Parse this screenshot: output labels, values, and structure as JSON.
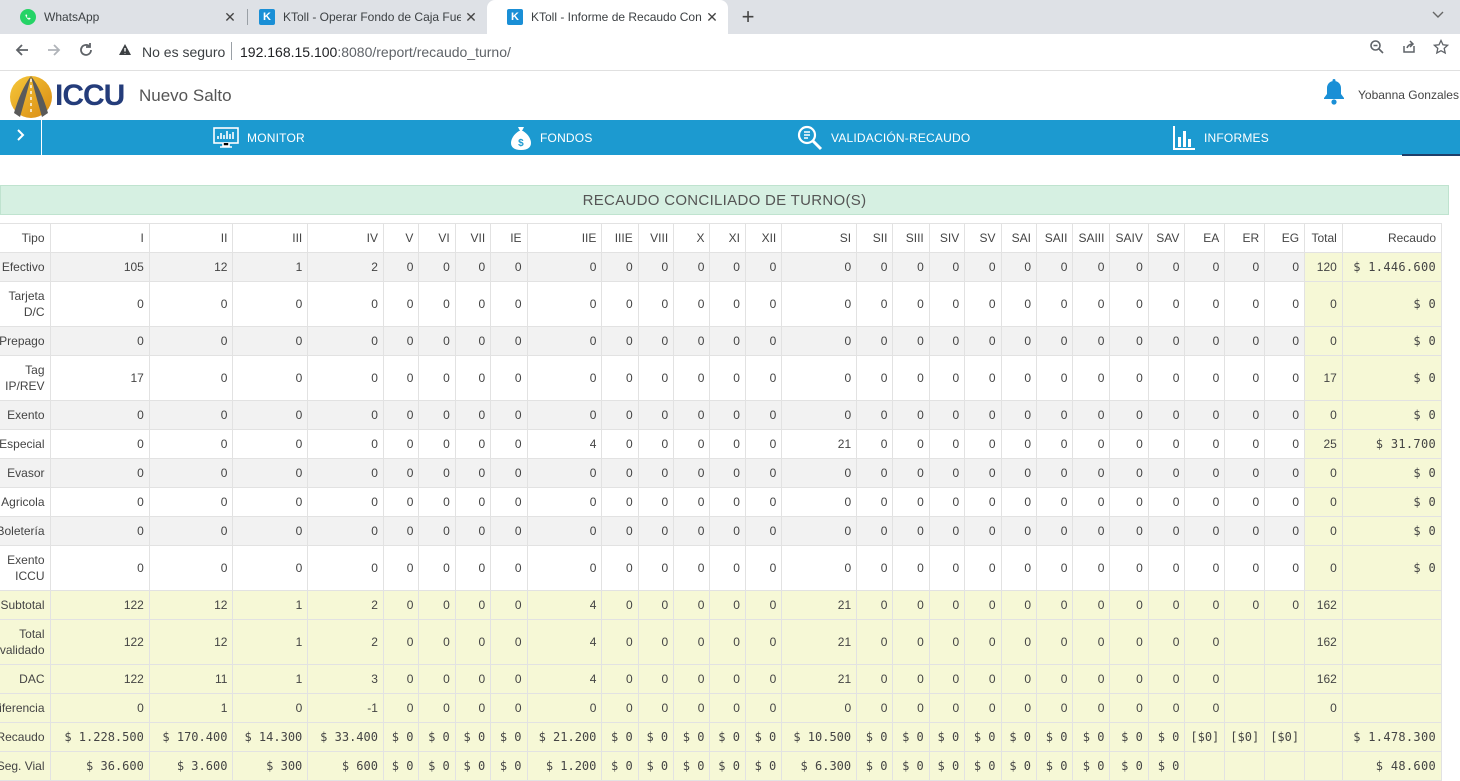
{
  "browser": {
    "tabs": [
      {
        "title": "WhatsApp",
        "icon": "whatsapp-icon",
        "active": false
      },
      {
        "title": "KToll - Operar Fondo de Caja Fuerte",
        "icon": "ktoll-icon",
        "active": false
      },
      {
        "title": "KToll - Informe de Recaudo Conciliado",
        "icon": "ktoll-icon",
        "active": true
      }
    ],
    "security_label": "No es seguro",
    "url_host": "192.168.15.100",
    "url_rest": ":8080/report/recaudo_turno/"
  },
  "header": {
    "logo_text": "ICCU",
    "site_name": "Nuevo Salto",
    "user_name": "Yobanna Gonzales"
  },
  "nav": {
    "items": [
      {
        "label": "MONITOR",
        "icon": "monitor-icon"
      },
      {
        "label": "FONDOS",
        "icon": "money-bag-icon"
      },
      {
        "label": "VALIDACIÓN-RECAUDO",
        "icon": "validation-search-icon"
      },
      {
        "label": "INFORMES",
        "icon": "bar-chart-icon"
      }
    ]
  },
  "report": {
    "title": "RECAUDO CONCILIADO DE TURNO(S)",
    "columns": [
      "Tipo",
      "I",
      "II",
      "III",
      "IV",
      "V",
      "VI",
      "VII",
      "IE",
      "IIE",
      "IIIE",
      "VIII",
      "X",
      "XI",
      "XII",
      "SI",
      "SII",
      "SIII",
      "SIV",
      "SV",
      "SAI",
      "SAII",
      "SAIII",
      "SAIV",
      "SAV",
      "EA",
      "ER",
      "EG",
      "Total",
      "Recaudo"
    ],
    "rows": [
      {
        "label": "Efectivo",
        "cells": [
          "105",
          "12",
          "1",
          "2",
          "0",
          "0",
          "0",
          "0",
          "0",
          "0",
          "0",
          "0",
          "0",
          "0",
          "0",
          "0",
          "0",
          "0",
          "0",
          "0",
          "0",
          "0",
          "0",
          "0",
          "0",
          "0",
          "0",
          "120",
          "$ 1.446.600"
        ]
      },
      {
        "label": "Tarjeta D/C",
        "cells": [
          "0",
          "0",
          "0",
          "0",
          "0",
          "0",
          "0",
          "0",
          "0",
          "0",
          "0",
          "0",
          "0",
          "0",
          "0",
          "0",
          "0",
          "0",
          "0",
          "0",
          "0",
          "0",
          "0",
          "0",
          "0",
          "0",
          "0",
          "0",
          "$ 0"
        ]
      },
      {
        "label": "Prepago",
        "cells": [
          "0",
          "0",
          "0",
          "0",
          "0",
          "0",
          "0",
          "0",
          "0",
          "0",
          "0",
          "0",
          "0",
          "0",
          "0",
          "0",
          "0",
          "0",
          "0",
          "0",
          "0",
          "0",
          "0",
          "0",
          "0",
          "0",
          "0",
          "0",
          "$ 0"
        ]
      },
      {
        "label": "Tag IP/REV",
        "cells": [
          "17",
          "0",
          "0",
          "0",
          "0",
          "0",
          "0",
          "0",
          "0",
          "0",
          "0",
          "0",
          "0",
          "0",
          "0",
          "0",
          "0",
          "0",
          "0",
          "0",
          "0",
          "0",
          "0",
          "0",
          "0",
          "0",
          "0",
          "17",
          "$ 0"
        ]
      },
      {
        "label": "Exento",
        "cells": [
          "0",
          "0",
          "0",
          "0",
          "0",
          "0",
          "0",
          "0",
          "0",
          "0",
          "0",
          "0",
          "0",
          "0",
          "0",
          "0",
          "0",
          "0",
          "0",
          "0",
          "0",
          "0",
          "0",
          "0",
          "0",
          "0",
          "0",
          "0",
          "$ 0"
        ]
      },
      {
        "label": "Especial",
        "cells": [
          "0",
          "0",
          "0",
          "0",
          "0",
          "0",
          "0",
          "0",
          "4",
          "0",
          "0",
          "0",
          "0",
          "0",
          "21",
          "0",
          "0",
          "0",
          "0",
          "0",
          "0",
          "0",
          "0",
          "0",
          "0",
          "0",
          "0",
          "25",
          "$ 31.700"
        ]
      },
      {
        "label": "Evasor",
        "cells": [
          "0",
          "0",
          "0",
          "0",
          "0",
          "0",
          "0",
          "0",
          "0",
          "0",
          "0",
          "0",
          "0",
          "0",
          "0",
          "0",
          "0",
          "0",
          "0",
          "0",
          "0",
          "0",
          "0",
          "0",
          "0",
          "0",
          "0",
          "0",
          "$ 0"
        ]
      },
      {
        "label": "Agricola",
        "cells": [
          "0",
          "0",
          "0",
          "0",
          "0",
          "0",
          "0",
          "0",
          "0",
          "0",
          "0",
          "0",
          "0",
          "0",
          "0",
          "0",
          "0",
          "0",
          "0",
          "0",
          "0",
          "0",
          "0",
          "0",
          "0",
          "0",
          "0",
          "0",
          "$ 0"
        ]
      },
      {
        "label": "Boletería",
        "cells": [
          "0",
          "0",
          "0",
          "0",
          "0",
          "0",
          "0",
          "0",
          "0",
          "0",
          "0",
          "0",
          "0",
          "0",
          "0",
          "0",
          "0",
          "0",
          "0",
          "0",
          "0",
          "0",
          "0",
          "0",
          "0",
          "0",
          "0",
          "0",
          "$ 0"
        ]
      },
      {
        "label": "Exento ICCU",
        "cells": [
          "0",
          "0",
          "0",
          "0",
          "0",
          "0",
          "0",
          "0",
          "0",
          "0",
          "0",
          "0",
          "0",
          "0",
          "0",
          "0",
          "0",
          "0",
          "0",
          "0",
          "0",
          "0",
          "0",
          "0",
          "0",
          "0",
          "0",
          "0",
          "$ 0"
        ]
      },
      {
        "label": "Subtotal",
        "cells": [
          "122",
          "12",
          "1",
          "2",
          "0",
          "0",
          "0",
          "0",
          "4",
          "0",
          "0",
          "0",
          "0",
          "0",
          "21",
          "0",
          "0",
          "0",
          "0",
          "0",
          "0",
          "0",
          "0",
          "0",
          "0",
          "0",
          "0",
          "162",
          ""
        ]
      },
      {
        "label": "Total validado",
        "cells": [
          "122",
          "12",
          "1",
          "2",
          "0",
          "0",
          "0",
          "0",
          "4",
          "0",
          "0",
          "0",
          "0",
          "0",
          "21",
          "0",
          "0",
          "0",
          "0",
          "0",
          "0",
          "0",
          "0",
          "0",
          "0",
          "",
          "",
          "162",
          ""
        ]
      },
      {
        "label": "DAC",
        "cells": [
          "122",
          "11",
          "1",
          "3",
          "0",
          "0",
          "0",
          "0",
          "4",
          "0",
          "0",
          "0",
          "0",
          "0",
          "21",
          "0",
          "0",
          "0",
          "0",
          "0",
          "0",
          "0",
          "0",
          "0",
          "0",
          "",
          "",
          "162",
          ""
        ]
      },
      {
        "label": "Diferencia",
        "cells": [
          "0",
          "1",
          "0",
          "-1",
          "0",
          "0",
          "0",
          "0",
          "0",
          "0",
          "0",
          "0",
          "0",
          "0",
          "0",
          "0",
          "0",
          "0",
          "0",
          "0",
          "0",
          "0",
          "0",
          "0",
          "0",
          "",
          "",
          "0",
          ""
        ]
      },
      {
        "label": "Recaudo",
        "cells": [
          "$ 1.228.500",
          "$ 170.400",
          "$ 14.300",
          "$ 33.400",
          "$ 0",
          "$ 0",
          "$ 0",
          "$ 0",
          "$ 21.200",
          "$ 0",
          "$ 0",
          "$ 0",
          "$ 0",
          "$ 0",
          "$ 10.500",
          "$ 0",
          "$ 0",
          "$ 0",
          "$ 0",
          "$ 0",
          "$ 0",
          "$ 0",
          "$ 0",
          "$ 0",
          "[$0]",
          "[$0]",
          "[$0]",
          "",
          "$ 1.478.300"
        ]
      },
      {
        "label": "Seg. Vial",
        "cells": [
          "$ 36.600",
          "$ 3.600",
          "$ 300",
          "$ 600",
          "$ 0",
          "$ 0",
          "$ 0",
          "$ 0",
          "$ 1.200",
          "$ 0",
          "$ 0",
          "$ 0",
          "$ 0",
          "$ 0",
          "$ 6.300",
          "$ 0",
          "$ 0",
          "$ 0",
          "$ 0",
          "$ 0",
          "$ 0",
          "$ 0",
          "$ 0",
          "$ 0",
          "",
          "",
          "",
          "",
          "$ 48.600"
        ]
      }
    ]
  },
  "colors": {
    "nav_blue": "#1c9ad0",
    "title_band": "#d6f0e2",
    "highlight_yellow": "#f6f8d6",
    "row_shade": "#f2f2f2"
  }
}
